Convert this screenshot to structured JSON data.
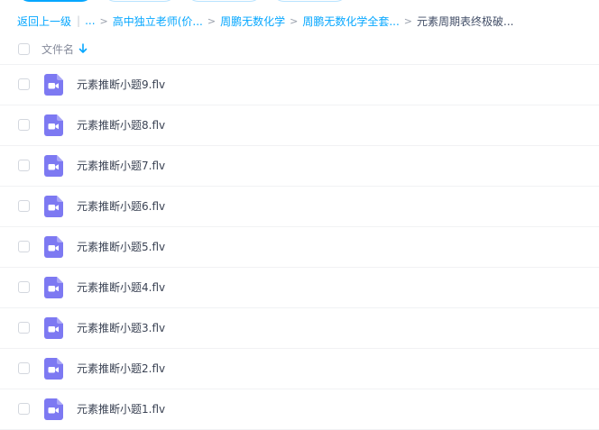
{
  "breadcrumb": {
    "back": "返回上一级",
    "ellipsis": "...",
    "items": [
      "高中独立老师(价...",
      "周鹏无数化学",
      "周鹏无数化学全套...",
      "元素周期表终极破..."
    ],
    "separator": ">"
  },
  "header": {
    "column_name": "文件名"
  },
  "files": [
    "元素推断小题9.flv",
    "元素推断小题8.flv",
    "元素推断小题7.flv",
    "元素推断小题6.flv",
    "元素推断小题5.flv",
    "元素推断小题4.flv",
    "元素推断小题3.flv",
    "元素推断小题2.flv",
    "元素推断小题1.flv"
  ],
  "colors": {
    "accent": "#06a7ff",
    "video_icon": "#7d79f2"
  },
  "icons": {
    "file": "video-file-icon",
    "sort": "arrow-down-icon"
  }
}
